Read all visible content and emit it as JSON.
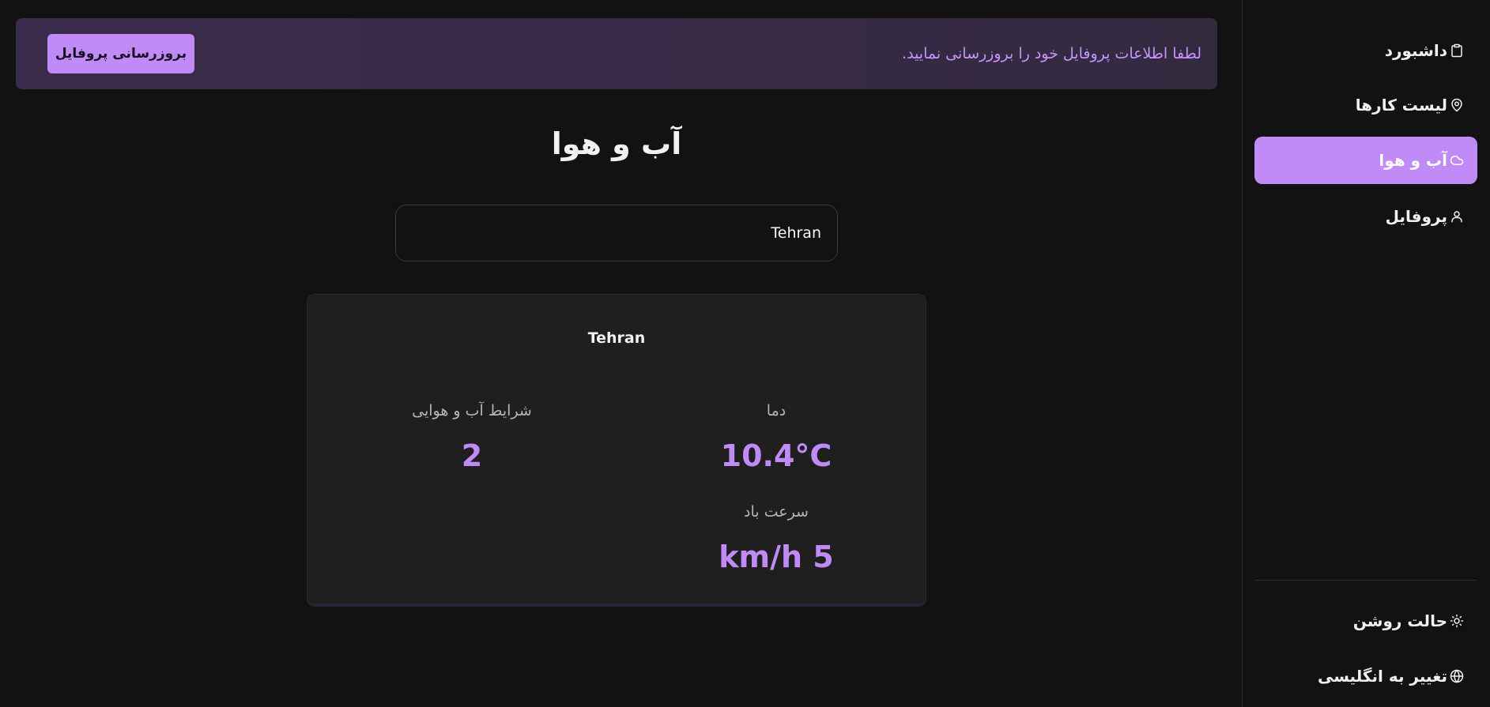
{
  "banner": {
    "message": "لطفا اطلاعات پروفایل خود را بروزرسانی نمایید.",
    "button_label": "بروزرسانی پروفایل"
  },
  "page": {
    "title": "آب و هوا"
  },
  "search": {
    "value": "Tehran"
  },
  "weather": {
    "city": "Tehran",
    "temperature_label": "دما",
    "temperature_value": "10.4°C",
    "condition_label": "شرایط آب و هوایی",
    "condition_value": "2",
    "wind_label": "سرعت باد",
    "wind_value": "km/h 5"
  },
  "sidebar": {
    "items": [
      {
        "label": "داشبورد",
        "icon": "clipboard-icon",
        "active": false
      },
      {
        "label": "لیست کارها",
        "icon": "map-pin-icon",
        "active": false
      },
      {
        "label": "آب و هوا",
        "icon": "cloud-icon",
        "active": true
      },
      {
        "label": "پروفایل",
        "icon": "user-icon",
        "active": false
      }
    ],
    "bottom": [
      {
        "label": "حالت روشن",
        "icon": "sun-icon"
      },
      {
        "label": "تغییر به انگلیسی",
        "icon": "globe-icon"
      }
    ]
  },
  "colors": {
    "accent": "#c08af7",
    "background": "#121212",
    "card": "#1f1f1f",
    "banner": "#3b2b4c"
  }
}
